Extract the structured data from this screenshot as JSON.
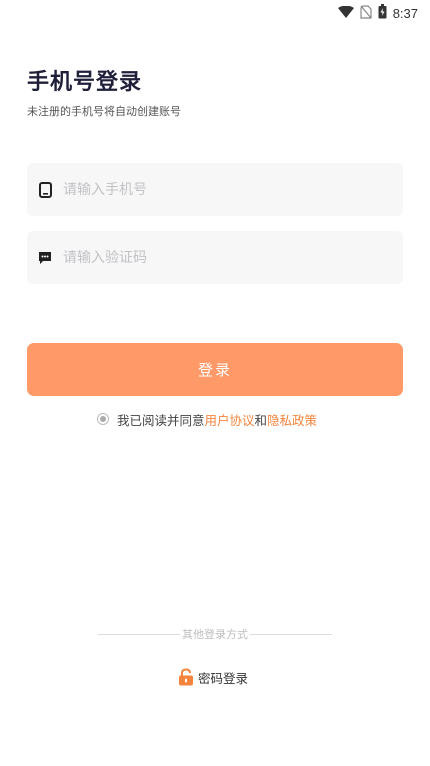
{
  "status_bar": {
    "time": "8:37"
  },
  "header": {
    "title": "手机号登录",
    "subtitle": "未注册的手机号将自动创建账号"
  },
  "form": {
    "phone_placeholder": "请输入手机号",
    "code_placeholder": "请输入验证码",
    "login_label": "登录"
  },
  "agreement": {
    "prefix": "我已阅读并同意",
    "user_agreement": "用户协议",
    "and": "和",
    "privacy_policy": "隐私政策"
  },
  "other_login": {
    "divider_label": "其他登录方式",
    "password_login_label": "密码登录"
  },
  "colors": {
    "accent": "#ff9968",
    "link": "#f5843d",
    "field_bg": "#f7f7f8"
  }
}
